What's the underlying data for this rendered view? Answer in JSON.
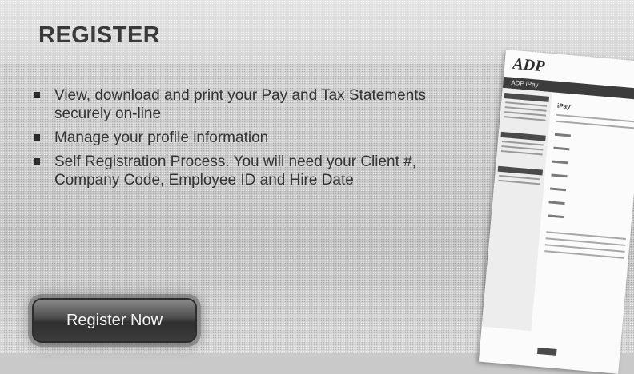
{
  "slide": {
    "title": "REGISTER",
    "bullets": [
      "View, download and print your Pay and Tax Statements securely on-line",
      "Manage your profile information",
      "Self Registration Process. You will need your Client #, Company Code, Employee ID and Hire Date"
    ],
    "register_button_label": "Register Now"
  },
  "thumbnail": {
    "logo_text": "ADP",
    "header_text": "ADP iPay",
    "heading_text": "iPay"
  },
  "colors": {
    "background": "#cfcfcf",
    "title_text": "#3a3a3a",
    "body_text": "#333333",
    "button": "#3c3c3c"
  },
  "icons": {
    "bullet": "square-bullet-icon"
  }
}
